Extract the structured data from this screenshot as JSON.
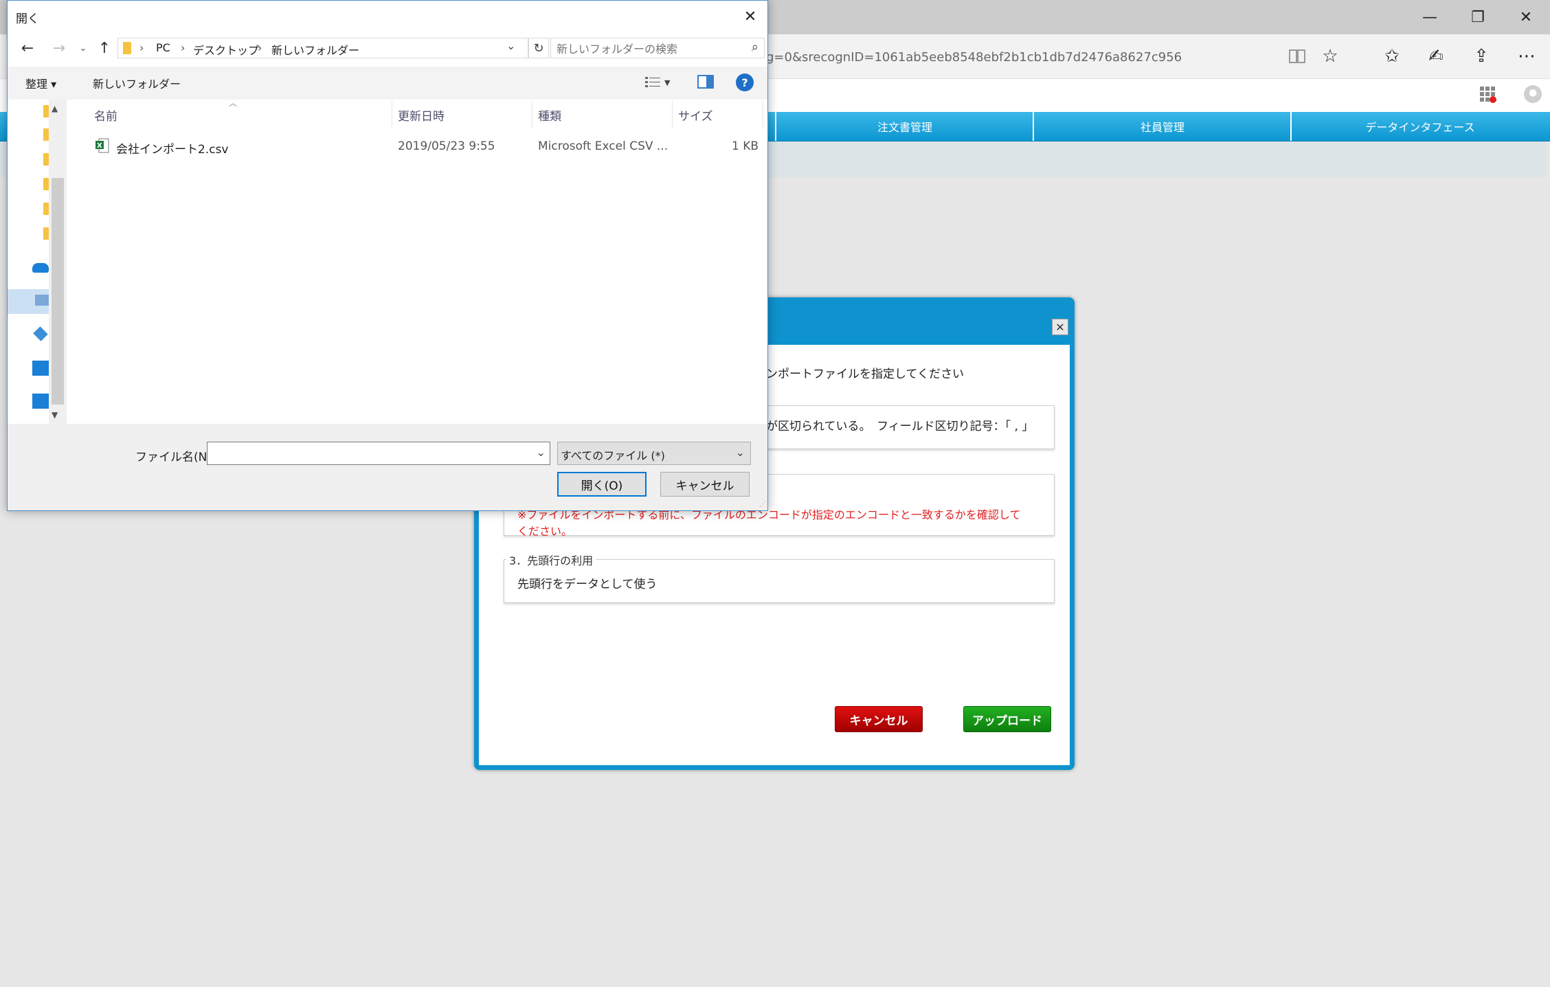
{
  "browser": {
    "url": "g=0&srecognID=1061ab5eeb8548ebf2b1cb1db7d2476a8627c956",
    "window_controls": {
      "minimize": "—",
      "restore": "❐",
      "close": "✕"
    }
  },
  "app_nav": {
    "tabs": [
      {
        "label": "注文書管理"
      },
      {
        "label": "社員管理"
      },
      {
        "label": "データインタフェース"
      }
    ]
  },
  "import_modal": {
    "instruction": "ンポートファイルを指定してください",
    "section1_text": "が区切られている。　フィールド区切り記号：「 , 」",
    "section2_warning": "※ファイルをインポートする前に、ファイルのエンコードが指定のエンコードと一致するかを確認して",
    "section2_warning_line2": "ください。",
    "section3_legend": "3．先頭行の利用",
    "section3_option": "先頭行をデータとして使う",
    "cancel_label": "キャンセル",
    "upload_label": "アップロード",
    "colors": {
      "frame": "#0e93cf",
      "cancel": "#cc0000",
      "upload": "#1a9a1a"
    }
  },
  "file_dialog": {
    "title": "開く",
    "breadcrumb": [
      "PC",
      "デスクトップ",
      "新しいフォルダー"
    ],
    "search_placeholder": "新しいフォルダーの検索",
    "toolbar": {
      "organize": "整理 ▾",
      "new_folder": "新しいフォルダー"
    },
    "columns": {
      "name": "名前",
      "modified": "更新日時",
      "type": "種類",
      "size": "サイズ"
    },
    "files": [
      {
        "name": "会社インポート2.csv",
        "modified": "2019/05/23 9:55",
        "type": "Microsoft Excel CSV ...",
        "size": "1 KB"
      }
    ],
    "filename_label": "ファイル名(N):",
    "filename_value": "",
    "filetype_value": "すべてのファイル (*)",
    "open_label": "開く(O)",
    "cancel_label": "キャンセル"
  }
}
